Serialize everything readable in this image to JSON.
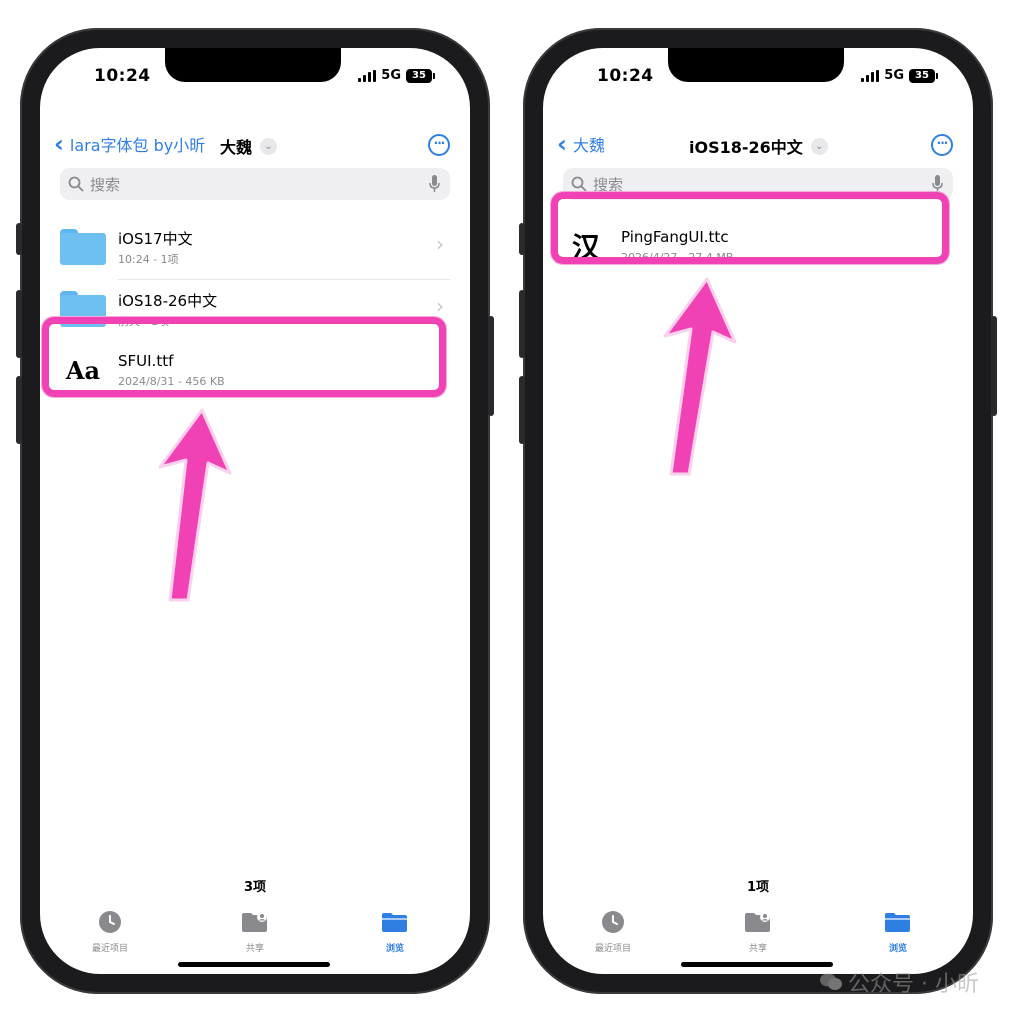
{
  "colors": {
    "accent": "#2f7fe3",
    "highlight": "#f042b4",
    "folder": "#6ec0f1"
  },
  "left": {
    "status": {
      "time": "10:24",
      "network": "5G",
      "battery": "35"
    },
    "nav": {
      "back_label": "lara字体包 by小昕",
      "title": "大魏"
    },
    "search": {
      "placeholder": "搜索"
    },
    "items": [
      {
        "name": "iOS17中文",
        "meta": "10:24 - 1项",
        "icon": "folder-icon"
      },
      {
        "name": "iOS18-26中文",
        "meta": "前天 - 1项",
        "icon": "folder-icon"
      },
      {
        "name": "SFUI.ttf",
        "meta": "2024/8/31 - 456 KB",
        "icon": "font-file-icon",
        "glyph": "Aa"
      }
    ],
    "count": "3项",
    "tabs": [
      {
        "label": "最近项目",
        "icon": "clock-icon"
      },
      {
        "label": "共享",
        "icon": "shared-folder-icon"
      },
      {
        "label": "浏览",
        "icon": "browse-folder-icon"
      }
    ]
  },
  "right": {
    "status": {
      "time": "10:24",
      "network": "5G",
      "battery": "35"
    },
    "nav": {
      "back_label": "大魏",
      "title": "iOS18-26中文"
    },
    "search": {
      "placeholder": "搜索"
    },
    "items": [
      {
        "name": "PingFangUI.ttc",
        "meta": "2026/4/27 - 27.4 MB",
        "icon": "font-file-icon",
        "glyph": "汉"
      }
    ],
    "count": "1项",
    "tabs": [
      {
        "label": "最近项目",
        "icon": "clock-icon"
      },
      {
        "label": "共享",
        "icon": "shared-folder-icon"
      },
      {
        "label": "浏览",
        "icon": "browse-folder-icon"
      }
    ]
  },
  "watermark": {
    "text": "公众号 · 小昕"
  }
}
